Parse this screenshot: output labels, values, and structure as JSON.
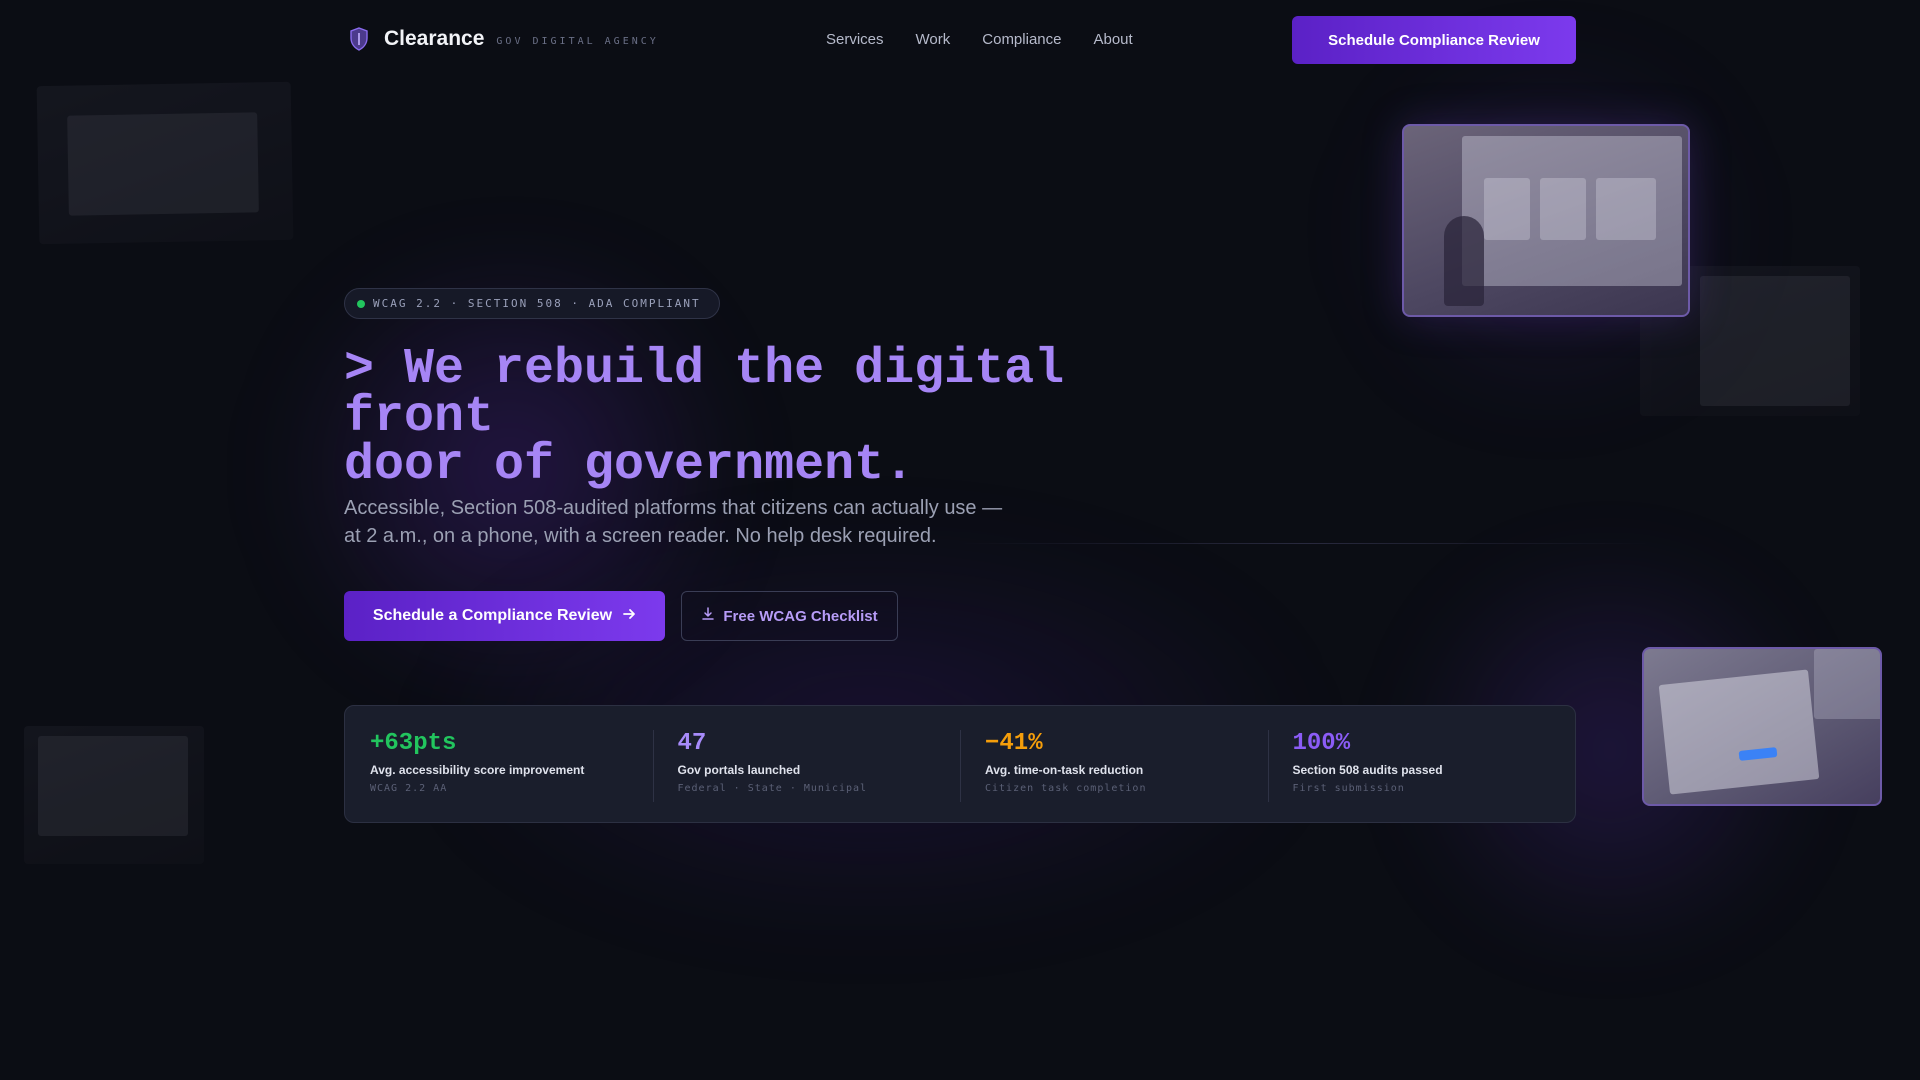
{
  "nav": {
    "brand_name": "Clearance",
    "brand_tag": "GOV DIGITAL AGENCY",
    "links": [
      "Services",
      "Work",
      "Compliance",
      "About"
    ],
    "cta_label": "Schedule Compliance Review"
  },
  "hero": {
    "badge": "WCAG 2.2 · SECTION 508 · ADA COMPLIANT",
    "headline_line1": "> We rebuild the digital front",
    "headline_line2": "door of government.",
    "subhead": "Accessible, Section 508-audited platforms that citizens can actually use — at 2 a.m., on a phone, with a screen reader. No help desk required.",
    "primary_cta": "Schedule a Compliance Review",
    "secondary_cta": "Free WCAG Checklist"
  },
  "stats": [
    {
      "value": "+63pts",
      "label": "Avg. accessibility score improvement",
      "sub": "WCAG 2.2 AA",
      "color": "#22c55e"
    },
    {
      "value": "47",
      "label": "Gov portals launched",
      "sub": "Federal · State · Municipal",
      "color": "#a78bfa"
    },
    {
      "value": "−41%",
      "label": "Avg. time-on-task reduction",
      "sub": "Citizen task completion",
      "color": "#f59e0b"
    },
    {
      "value": "100%",
      "label": "Section 508 audits passed",
      "sub": "First submission",
      "color": "#8b5cf6"
    }
  ],
  "colors": {
    "background": "#0b0d14",
    "accent": "#7c3aed",
    "headline": "#a685f5",
    "status_dot": "#22c55e"
  },
  "icons": {
    "brand": "shield-icon",
    "primary_cta": "arrow-right-icon",
    "secondary_cta": "download-icon"
  }
}
